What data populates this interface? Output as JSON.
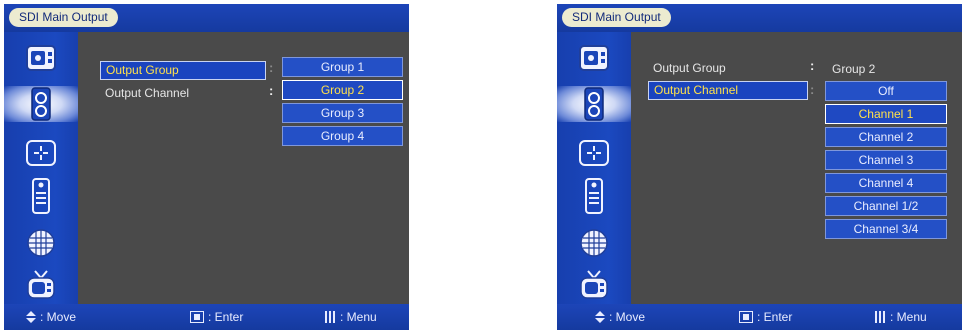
{
  "screens": [
    {
      "title": "SDI Main Output",
      "labels": {
        "output_group": "Output Group",
        "output_channel": "Output Channel"
      },
      "current_value": "",
      "options": [
        "Group 1",
        "Group 2",
        "Group 3",
        "Group 4"
      ],
      "selected_option_index": 1,
      "hints": {
        "move": ": Move",
        "enter": ": Enter",
        "menu": ": Menu"
      }
    },
    {
      "title": "SDI Main Output",
      "labels": {
        "output_group": "Output Group",
        "output_channel": "Output Channel"
      },
      "current_value": "Group 2",
      "options": [
        "Off",
        "Channel 1",
        "Channel 2",
        "Channel 3",
        "Channel 4",
        "Channel 1/2",
        "Channel 3/4"
      ],
      "selected_option_index": 1,
      "hints": {
        "move": ": Move",
        "enter": ": Enter",
        "menu": ": Menu"
      }
    }
  ],
  "sidebar_icons": [
    "picture-icon",
    "audio-speaker-icon",
    "crosshair-icon",
    "remote-control-icon",
    "globe-mesh-icon",
    "tv-icon"
  ],
  "colors": {
    "accent_selected_text": "#ffe14a",
    "bar_blue": "#1d45b8",
    "panel_gray": "#4a4a4a"
  }
}
